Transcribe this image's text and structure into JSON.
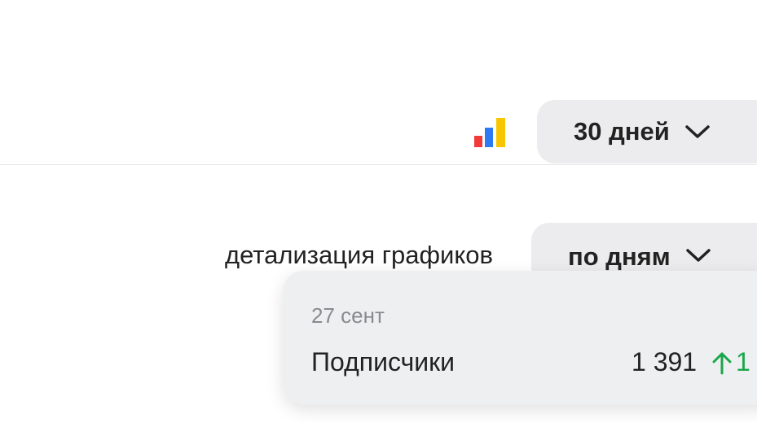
{
  "header": {
    "metrica_icon": "bar-chart-colored-icon",
    "period_select": {
      "value": "30 дней",
      "icon": "chevron-down-icon"
    }
  },
  "chart_controls": {
    "detail_label": "детализация графиков",
    "granularity_select": {
      "value": "по дням",
      "icon": "chevron-down-icon"
    }
  },
  "tooltip": {
    "date": "27 сент",
    "metric_name": "Подписчики",
    "metric_value": "1 391",
    "delta_icon": "arrow-up-icon",
    "delta_value": "1"
  },
  "colors": {
    "accent_red": "#f23a3a",
    "accent_blue": "#2e7af5",
    "accent_yellow": "#f7c600",
    "positive": "#1aa64a",
    "control_bg": "#ececee"
  }
}
